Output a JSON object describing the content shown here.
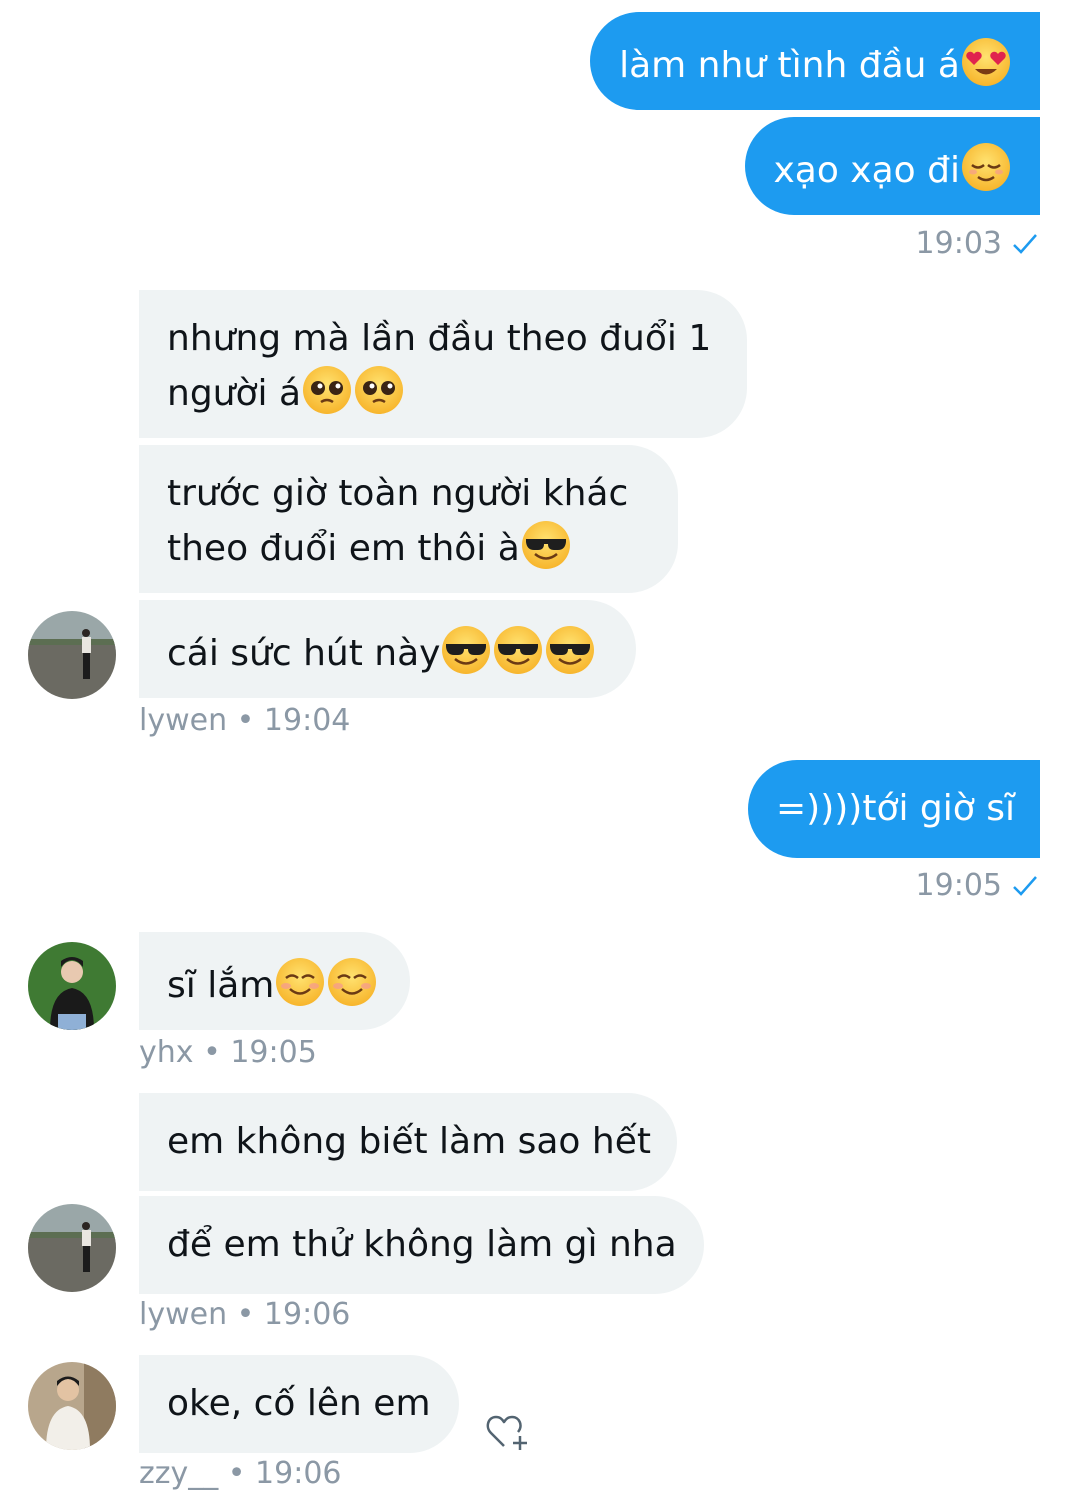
{
  "messages": {
    "m1": {
      "text": "làm như tình đầu á"
    },
    "m2": {
      "text": "xạo xạo đi"
    },
    "meta1": {
      "time": "19:03"
    },
    "m3": {
      "line1": "nhưng mà lần đầu theo đuổi 1",
      "line2": "người á"
    },
    "m4": {
      "line1": "trước giờ toàn người khác",
      "line2": "theo đuổi em thôi à"
    },
    "m5": {
      "text": "cái sức hút này"
    },
    "meta2": {
      "sender": "lywen",
      "sep": "•",
      "time": "19:04"
    },
    "m6": {
      "text": "=))))tới giờ sĩ"
    },
    "meta3": {
      "time": "19:05"
    },
    "m7": {
      "text": "sĩ lắm"
    },
    "meta4": {
      "sender": "yhx",
      "sep": "•",
      "time": "19:05"
    },
    "m8": {
      "text": "em không biết làm sao hết"
    },
    "m9": {
      "text": "để em thử không làm gì nha"
    },
    "meta5": {
      "sender": "lywen",
      "sep": "•",
      "time": "19:06"
    },
    "m10": {
      "text": "oke, cố lên em"
    },
    "meta6": {
      "sender": "zzy__",
      "sep": "•",
      "time": "19:06"
    }
  },
  "colors": {
    "outgoing_bubble": "#1d9bf0",
    "incoming_bubble": "#eff3f4",
    "meta_text": "#8b98a5",
    "read_check": "#1d9bf0"
  },
  "icons": {
    "heart_eyes": "smiling-face-with-heart-eyes-icon",
    "relieved": "relieved-face-icon",
    "pleading": "pleading-face-icon",
    "sunglasses": "smiling-face-with-sunglasses-icon",
    "smiling": "smiling-face-icon",
    "check": "read-check-icon",
    "react": "add-reaction-heart-icon"
  }
}
